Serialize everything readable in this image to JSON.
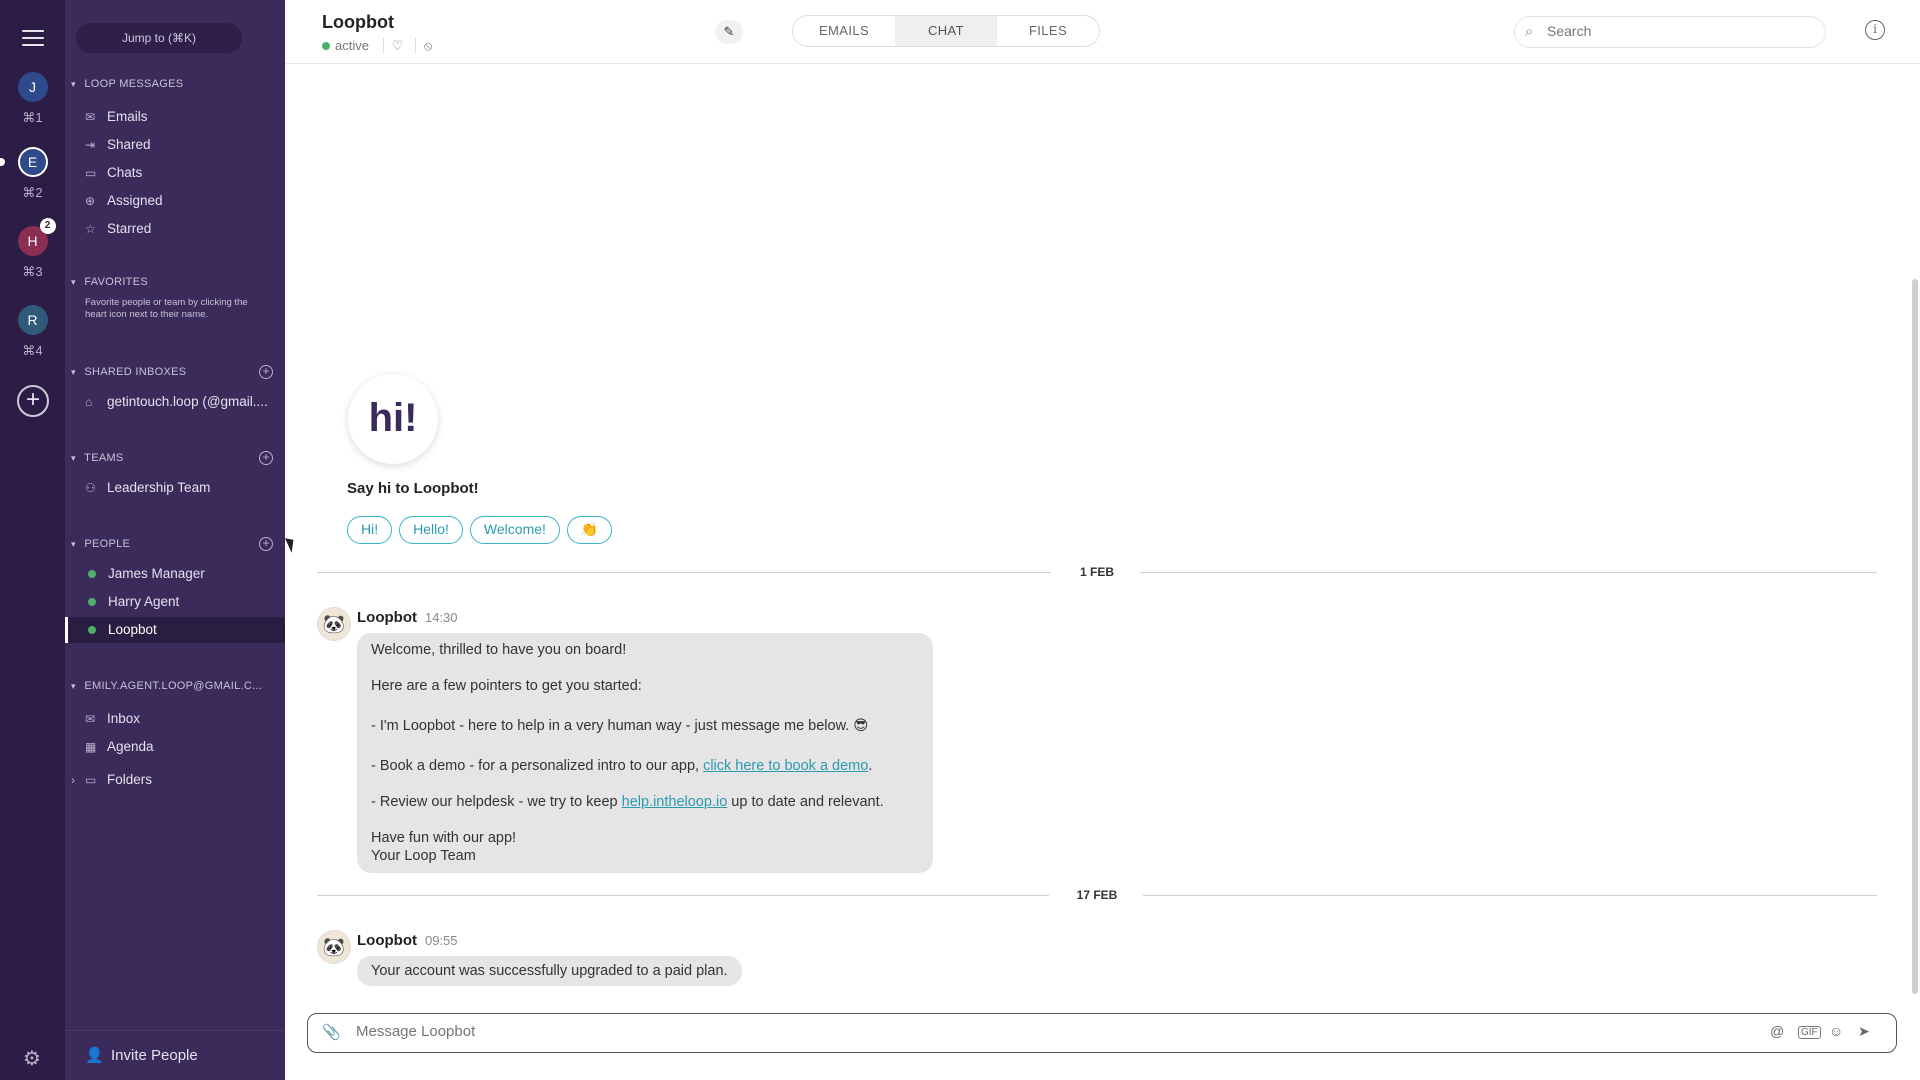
{
  "rail": {
    "accounts": [
      {
        "initial": "J",
        "shortcut": "⌘1",
        "color": "#2f4a8a"
      },
      {
        "initial": "E",
        "shortcut": "⌘2",
        "color": "#2f4a8a"
      },
      {
        "initial": "H",
        "shortcut": "⌘3",
        "color": "#8a2f52",
        "badge": "2"
      },
      {
        "initial": "R",
        "shortcut": "⌘4",
        "color": "#2f5a7a"
      }
    ]
  },
  "sidebar": {
    "jump_label": "Jump to (⌘K)",
    "loop_messages": {
      "header": "LOOP MESSAGES",
      "items": [
        "Emails",
        "Shared",
        "Chats",
        "Assigned",
        "Starred"
      ]
    },
    "favorites": {
      "header": "FAVORITES",
      "note": "Favorite people or team by clicking the heart icon next to their name."
    },
    "shared_inboxes": {
      "header": "SHARED INBOXES",
      "items": [
        "getintouch.loop (@gmail...."
      ]
    },
    "teams": {
      "header": "TEAMS",
      "items": [
        "Leadership Team"
      ]
    },
    "people": {
      "header": "PEOPLE",
      "items": [
        "James Manager",
        "Harry Agent",
        "Loopbot"
      ]
    },
    "account": {
      "header": "EMILY.AGENT.LOOP@GMAIL.C...",
      "items": [
        "Inbox",
        "Agenda",
        "Folders"
      ]
    },
    "invite_label": "Invite People"
  },
  "header": {
    "title": "Loopbot",
    "status": "active",
    "tabs": [
      "EMAILS",
      "CHAT",
      "FILES"
    ],
    "active_tab": "CHAT",
    "search_placeholder": "Search"
  },
  "chat": {
    "hi_text": "hi!",
    "say_hi": "Say hi to Loopbot!",
    "chips": [
      "Hi!",
      "Hello!",
      "Welcome!",
      "👏"
    ],
    "messages": [
      {
        "date": "1 FEB",
        "sender": "Loopbot",
        "time": "14:30",
        "lines": {
          "l1": "Welcome, thrilled to have you on board!",
          "l2": "Here are a few pointers to get you started:",
          "l3": "- I'm Loopbot -  here to help in a very human way - just message me below. 😎",
          "l4_pre": "- Book a demo - for a personalized intro to our app, ",
          "l4_link": "click here to book a demo",
          "l4_post": ".",
          "l5_pre": "- Review our helpdesk - we try to keep ",
          "l5_link": "help.intheloop.io",
          "l5_post": " up to date and relevant.",
          "l6": "Have fun with our app!",
          "l7": "Your Loop Team"
        }
      },
      {
        "date": "17 FEB",
        "sender": "Loopbot",
        "time": "09:55",
        "text": "Your account was successfully upgraded to a paid plan."
      }
    ]
  },
  "composer": {
    "placeholder": "Message Loopbot"
  }
}
